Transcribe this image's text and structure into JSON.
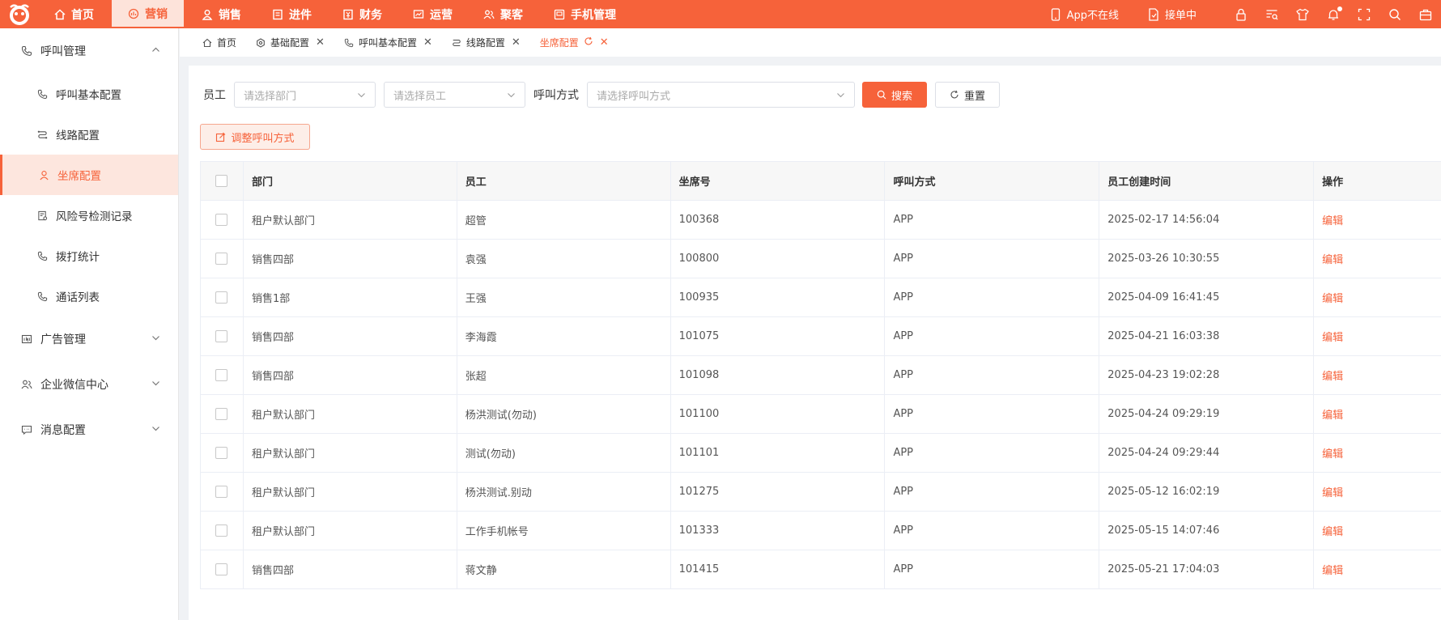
{
  "topbar": {
    "nav": [
      {
        "label": "首页",
        "icon": "home-icon"
      },
      {
        "label": "营销",
        "icon": "marketing-icon",
        "active": true
      },
      {
        "label": "销售",
        "icon": "person-icon"
      },
      {
        "label": "进件",
        "icon": "document-icon"
      },
      {
        "label": "财务",
        "icon": "finance-icon"
      },
      {
        "label": "运营",
        "icon": "chart-icon"
      },
      {
        "label": "聚客",
        "icon": "group-icon"
      },
      {
        "label": "手机管理",
        "icon": "phone-manage-icon"
      }
    ],
    "app_status": "App不在线",
    "order_status": "接单中"
  },
  "sidebar": {
    "group_call": "呼叫管理",
    "items": [
      {
        "label": "呼叫基本配置"
      },
      {
        "label": "线路配置"
      },
      {
        "label": "坐席配置",
        "active": true
      },
      {
        "label": "风险号检测记录"
      },
      {
        "label": "拨打统计"
      },
      {
        "label": "通话列表"
      }
    ],
    "group_ad": "广告管理",
    "group_wecom": "企业微信中心",
    "group_msg": "消息配置"
  },
  "tabs": [
    {
      "label": "首页",
      "closable": false
    },
    {
      "label": "基础配置",
      "closable": true
    },
    {
      "label": "呼叫基本配置",
      "closable": true
    },
    {
      "label": "线路配置",
      "closable": true
    },
    {
      "label": "坐席配置",
      "closable": true,
      "active": true
    }
  ],
  "filters": {
    "employee_label": "员工",
    "dept_placeholder": "请选择部门",
    "emp_placeholder": "请选择员工",
    "call_method_label": "呼叫方式",
    "call_method_placeholder": "请选择呼叫方式",
    "search": "搜索",
    "reset": "重置"
  },
  "adjust_button": "调整呼叫方式",
  "table": {
    "headers": [
      "部门",
      "员工",
      "坐席号",
      "呼叫方式",
      "员工创建时间",
      "操作"
    ],
    "rows": [
      {
        "dept": "租户默认部门",
        "emp": "超管",
        "seat": "100368",
        "method": "APP",
        "created": "2025-02-17 14:56:04",
        "op": "编辑"
      },
      {
        "dept": "销售四部",
        "emp": "袁强",
        "seat": "100800",
        "method": "APP",
        "created": "2025-03-26 10:30:55",
        "op": "编辑"
      },
      {
        "dept": "销售1部",
        "emp": "王强",
        "seat": "100935",
        "method": "APP",
        "created": "2025-04-09 16:41:45",
        "op": "编辑"
      },
      {
        "dept": "销售四部",
        "emp": "李海霞",
        "seat": "101075",
        "method": "APP",
        "created": "2025-04-21 16:03:38",
        "op": "编辑"
      },
      {
        "dept": "销售四部",
        "emp": "张超",
        "seat": "101098",
        "method": "APP",
        "created": "2025-04-23 19:02:28",
        "op": "编辑"
      },
      {
        "dept": "租户默认部门",
        "emp": "杨洪测试(勿动)",
        "seat": "101100",
        "method": "APP",
        "created": "2025-04-24 09:29:19",
        "op": "编辑"
      },
      {
        "dept": "租户默认部门",
        "emp": "测试(勿动)",
        "seat": "101101",
        "method": "APP",
        "created": "2025-04-24 09:29:44",
        "op": "编辑"
      },
      {
        "dept": "租户默认部门",
        "emp": "杨洪测试.别动",
        "seat": "101275",
        "method": "APP",
        "created": "2025-05-12 16:02:19",
        "op": "编辑"
      },
      {
        "dept": "租户默认部门",
        "emp": "工作手机帐号",
        "seat": "101333",
        "method": "APP",
        "created": "2025-05-15 14:07:46",
        "op": "编辑"
      },
      {
        "dept": "销售四部",
        "emp": "蒋文静",
        "seat": "101415",
        "method": "APP",
        "created": "2025-05-21 17:04:03",
        "op": "编辑"
      }
    ]
  },
  "colors": {
    "brand": "#f6623a",
    "active_bg": "#fde6de"
  }
}
